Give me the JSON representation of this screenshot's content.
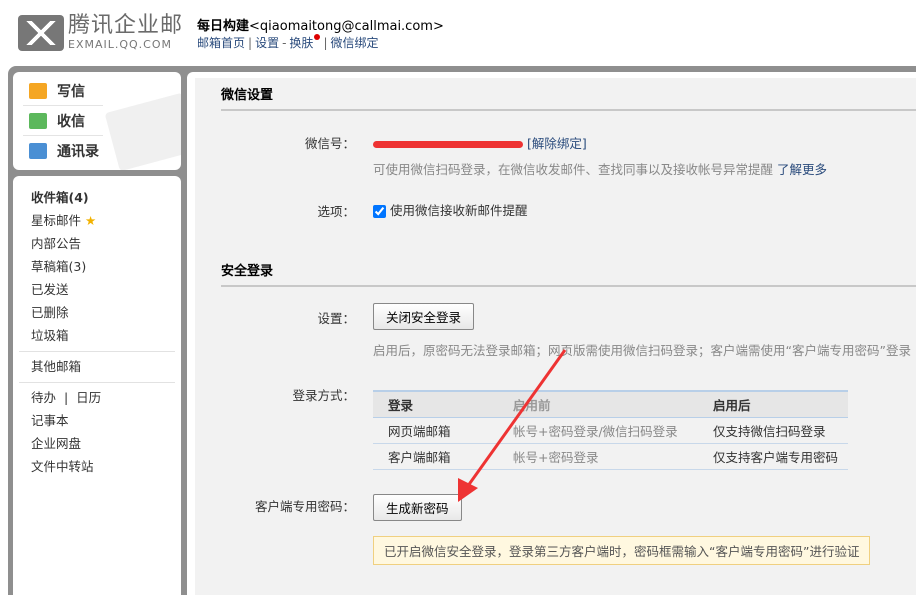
{
  "logo": {
    "cn": "腾讯企业邮",
    "en": "EXMAIL.QQ.COM"
  },
  "user": {
    "name": "每日构建",
    "email": "<qiaomaitong@callmai.com>"
  },
  "toplinks": [
    "邮箱首页",
    "设置",
    "换肤",
    "微信绑定"
  ],
  "actions": [
    {
      "label": "写信",
      "icon": "compose-icon"
    },
    {
      "label": "收信",
      "icon": "inbox-download-icon"
    },
    {
      "label": "通讯录",
      "icon": "contacts-icon"
    }
  ],
  "folders": [
    "收件箱(4)",
    "星标邮件",
    "内部公告",
    "草稿箱(3)",
    "已发送",
    "已删除",
    "垃圾箱"
  ],
  "other": "其他邮箱",
  "tools": {
    "todo": "待办",
    "calendar": "日历",
    "notes": "记事本",
    "disk": "企业网盘",
    "transfer": "文件中转站"
  },
  "wechat": {
    "title": "微信设置",
    "id_label": "微信号：",
    "unbind": "[解除绑定]",
    "desc": "可使用微信扫码登录，在微信收发邮件、查找同事以及接收帐号异常提醒",
    "more": "了解更多",
    "option_label": "选项：",
    "option_text": "使用微信接收新邮件提醒",
    "option_checked": true
  },
  "secure": {
    "title": "安全登录",
    "setting_label": "设置：",
    "toggle_button": "关闭安全登录",
    "desc": "启用后，原密码无法登录邮箱；网页版需使用微信扫码登录；客户端需使用“客户端专用密码”登录",
    "method_label": "登录方式：",
    "headers": [
      "登录",
      "启用前",
      "启用后"
    ],
    "rows": [
      [
        "网页端邮箱",
        "帐号+密码登录/微信扫码登录",
        "仅支持微信扫码登录"
      ],
      [
        "客户端邮箱",
        "帐号+密码登录",
        "仅支持客户端专用密码"
      ]
    ],
    "client_pw_label": "客户端专用密码：",
    "generate_button": "生成新密码",
    "notice": "已开启微信安全登录，登录第三方客户端时，密码框需输入“客户端专用密码”进行验证"
  },
  "colors": {
    "link": "#2a4b7c",
    "annotation": "#ee3333"
  }
}
